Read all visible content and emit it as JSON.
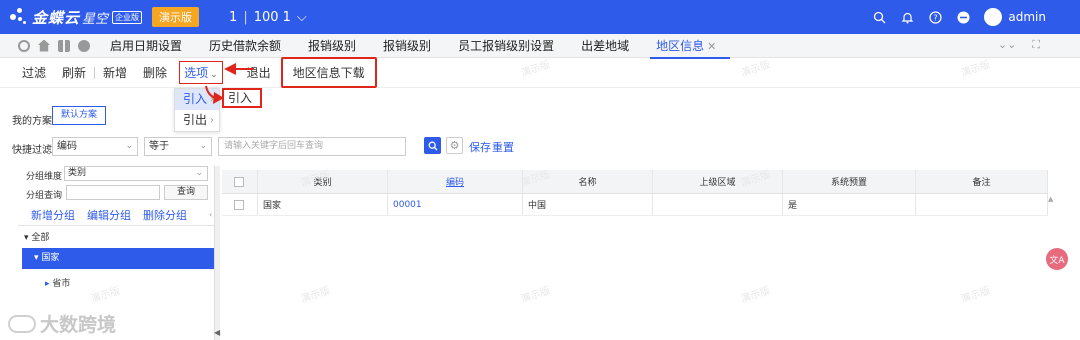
{
  "header": {
    "brand_name": "金蝶云",
    "brand_sub": "星空",
    "brand_badge": "企业版",
    "demo_badge": "演示版",
    "org_code": "1",
    "org_name": "100 1",
    "user": "admin",
    "accent_color": "#2f5bea"
  },
  "tabs": [
    {
      "label": "启用日期设置"
    },
    {
      "label": "历史借款余额"
    },
    {
      "label": "报销级别"
    },
    {
      "label": "报销级别"
    },
    {
      "label": "员工报销级别设置"
    },
    {
      "label": "出差地域"
    },
    {
      "label": "地区信息",
      "active": true
    }
  ],
  "toolbar": {
    "filter": "过滤",
    "refresh": "刷新",
    "new": "新增",
    "delete": "删除",
    "options": "选项",
    "exit": "退出",
    "download": "地区信息下载"
  },
  "options_menu": {
    "import": "引入",
    "export": "引出",
    "sub_import": "引入"
  },
  "scheme": {
    "label": "我的方案",
    "default_button": "默认方案"
  },
  "quick_filter": {
    "label": "快捷过滤",
    "field": "编码",
    "operator": "等于",
    "placeholder": "请输入关键字后回车查询",
    "save": "保存",
    "reset": "重置"
  },
  "left_panel": {
    "group_dim_label": "分组维度",
    "group_dim_value": "类别",
    "group_query_label": "分组查询",
    "query_button": "查询",
    "add_group": "新增分组",
    "edit_group": "编辑分组",
    "delete_group": "删除分组",
    "tree_root": "全部",
    "tree_selected": "国家",
    "tree_child": "省市"
  },
  "grid": {
    "columns": [
      "类别",
      "编码",
      "名称",
      "上级区域",
      "系统预置",
      "备注"
    ],
    "rows": [
      {
        "category": "国家",
        "code": "00001",
        "name": "中国",
        "parent": "",
        "preset": "是",
        "remark": ""
      }
    ]
  },
  "watermark": "演示版",
  "overlay_brand": "大数跨境"
}
